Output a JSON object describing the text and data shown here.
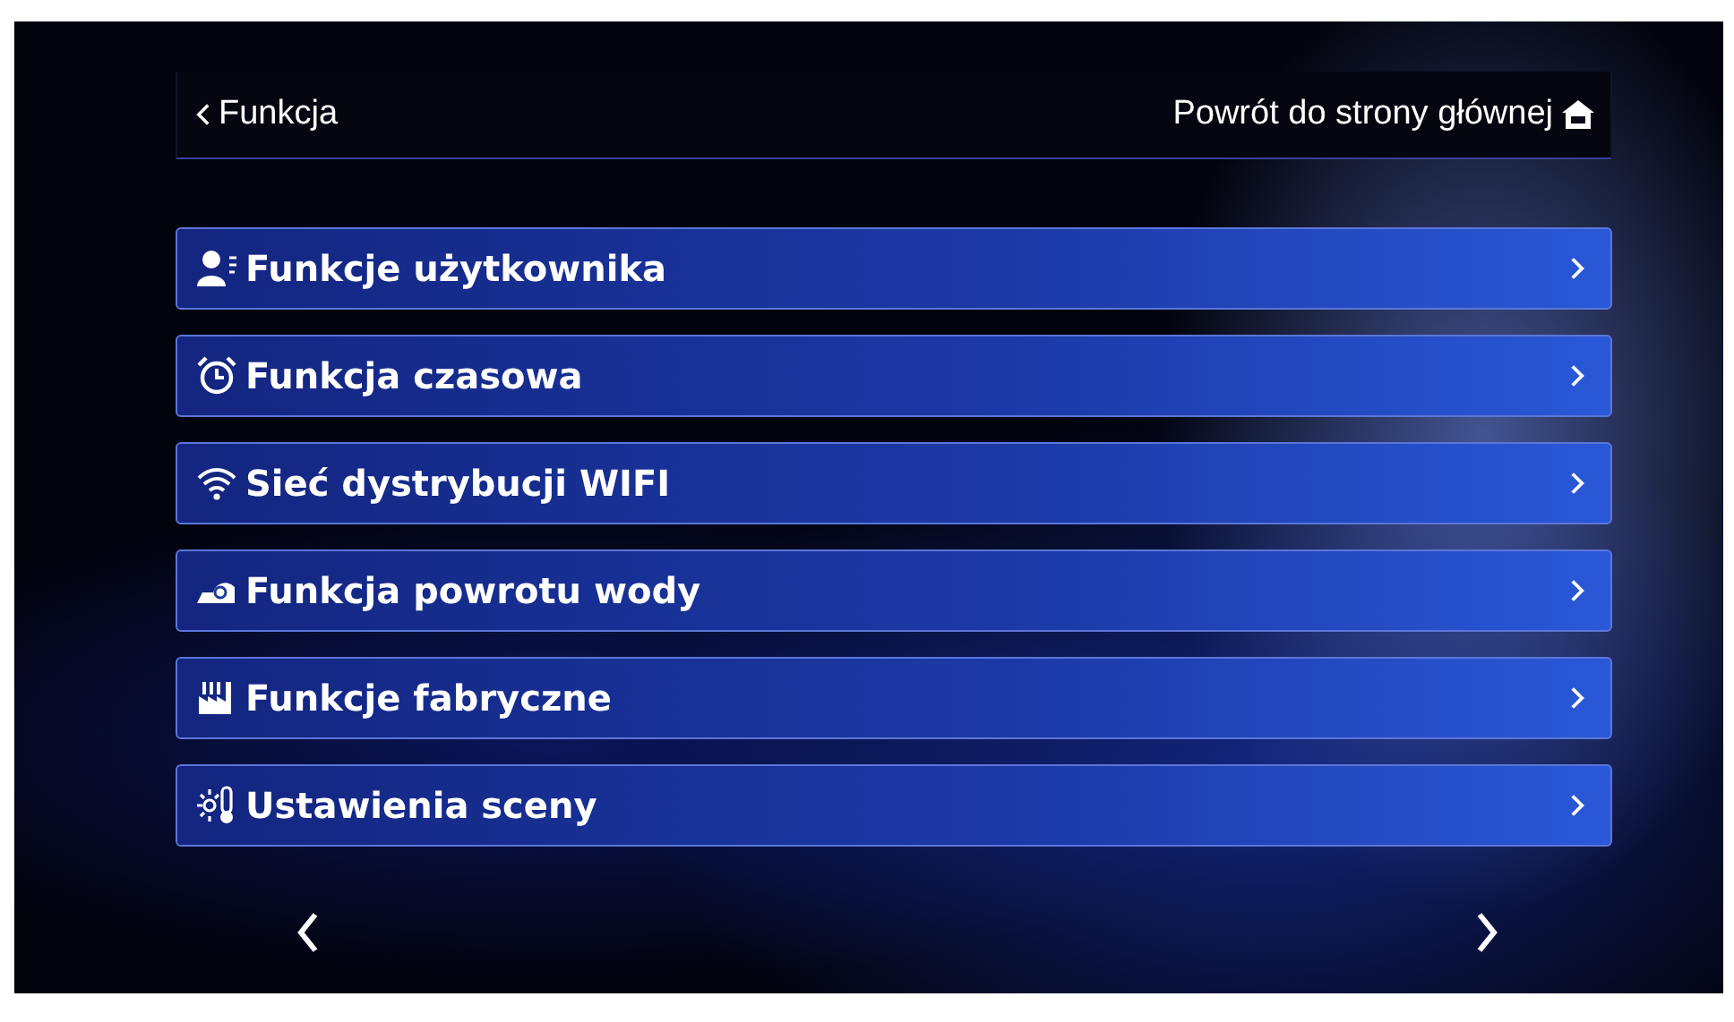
{
  "header": {
    "back_label": "Funkcja",
    "home_label": "Powrót do strony głównej"
  },
  "menu_items": [
    {
      "label": "Funkcje użytkownika"
    },
    {
      "label": "Funkcja czasowa"
    },
    {
      "label": "Sieć dystrybucji WIFI"
    },
    {
      "label": "Funkcja powrotu wody"
    },
    {
      "label": "Funkcje fabryczne"
    },
    {
      "label": "Ustawienia sceny"
    }
  ]
}
